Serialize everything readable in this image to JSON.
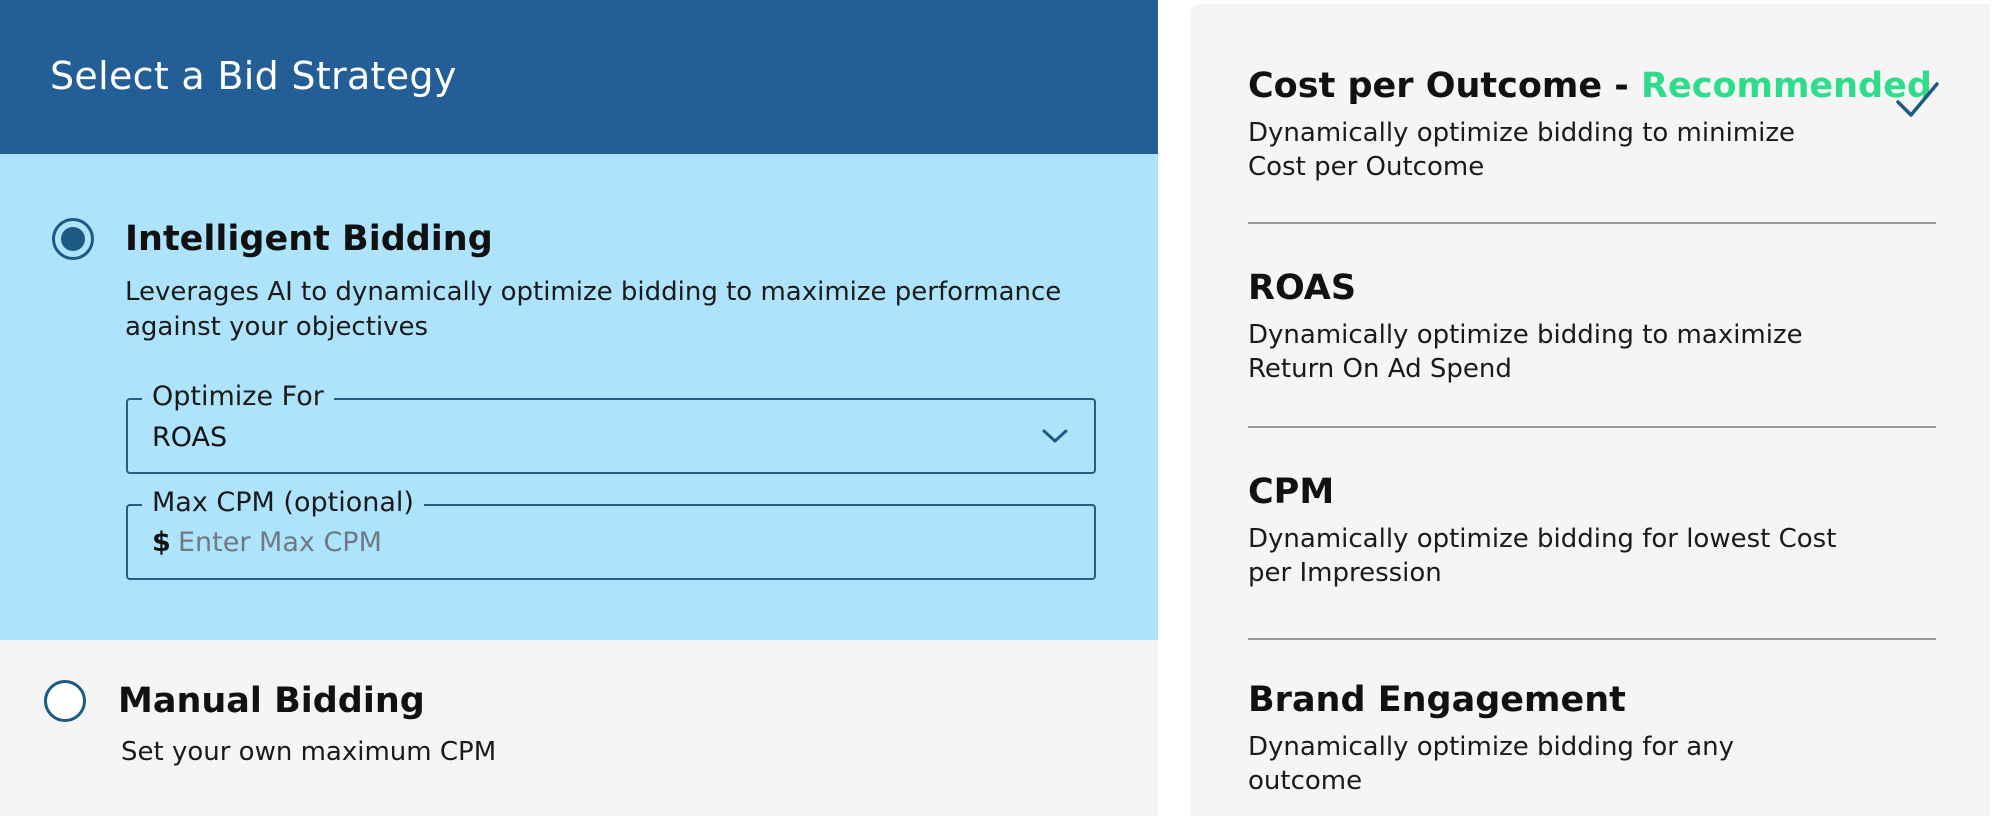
{
  "header": {
    "title": "Select a Bid Strategy"
  },
  "intelligent": {
    "title": "Intelligent Bidding",
    "description": "Leverages AI to dynamically optimize bidding to maximize performance against your objectives",
    "selected": true,
    "optimize_for": {
      "label": "Optimize For",
      "value": "ROAS"
    },
    "max_cpm": {
      "label": "Max CPM (optional)",
      "currency": "$",
      "placeholder": "Enter Max CPM",
      "value": ""
    }
  },
  "manual": {
    "title": "Manual Bidding",
    "description": "Set your own maximum CPM",
    "selected": false
  },
  "strategies": [
    {
      "title": "Cost per Outcome - ",
      "badge": "Recommended",
      "description": "Dynamically optimize bidding to minimize Cost per Outcome",
      "selected": true
    },
    {
      "title": "ROAS",
      "description": "Dynamically optimize bidding to maximize Return On Ad Spend"
    },
    {
      "title": "CPM",
      "description": "Dynamically optimize bidding for lowest Cost per Impression"
    },
    {
      "title": "Brand Engagement",
      "description": "Dynamically optimize bidding for any outcome"
    }
  ],
  "colors": {
    "header_bg": "#235f96",
    "selected_section_bg": "#ade3fb",
    "accent_dark": "#1b5a85",
    "recommended": "#2fdc8b",
    "panel_bg": "#f5f5f5"
  },
  "icons": {
    "dropdown": "chevron-down-icon",
    "selected_strategy": "checkmark-icon"
  }
}
